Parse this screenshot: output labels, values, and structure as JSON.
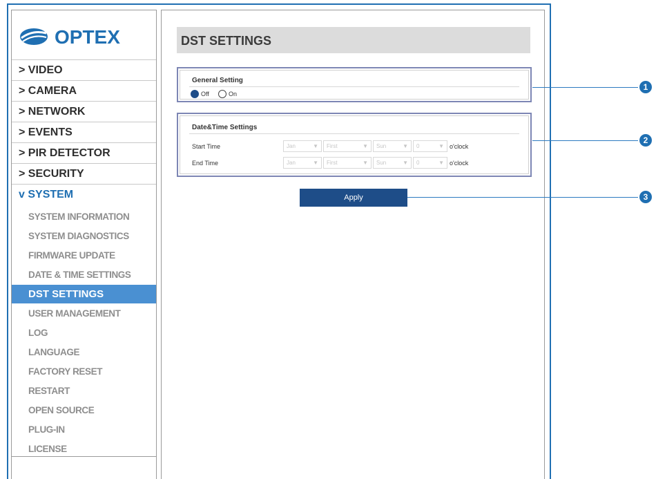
{
  "logo": {
    "text": "OPTEX"
  },
  "menu": [
    {
      "label": "> VIDEO"
    },
    {
      "label": "> CAMERA"
    },
    {
      "label": "> NETWORK"
    },
    {
      "label": "> EVENTS"
    },
    {
      "label": "> PIR DETECTOR"
    },
    {
      "label": "> SECURITY"
    },
    {
      "label": "v SYSTEM"
    }
  ],
  "submenu": [
    {
      "label": "SYSTEM INFORMATION"
    },
    {
      "label": "SYSTEM DIAGNOSTICS"
    },
    {
      "label": "FIRMWARE UPDATE"
    },
    {
      "label": "DATE & TIME SETTINGS"
    },
    {
      "label": "DST SETTINGS"
    },
    {
      "label": "USER MANAGEMENT"
    },
    {
      "label": "LOG"
    },
    {
      "label": "LANGUAGE"
    },
    {
      "label": "FACTORY RESET"
    },
    {
      "label": "RESTART"
    },
    {
      "label": "OPEN SOURCE"
    },
    {
      "label": "PLUG-IN"
    },
    {
      "label": "LICENSE"
    }
  ],
  "page": {
    "title": "DST SETTINGS"
  },
  "general": {
    "title": "General Setting",
    "off_label": "Off",
    "on_label": "On",
    "selected": "Off"
  },
  "datetime": {
    "title": "Date&Time Settings",
    "start_label": "Start Time",
    "end_label": "End Time",
    "start": {
      "month": "Jan",
      "week": "First",
      "day": "Sun",
      "hour": "0"
    },
    "end": {
      "month": "Jan",
      "week": "First",
      "day": "Sun",
      "hour": "0"
    },
    "oclock": "o'clock"
  },
  "apply_label": "Apply",
  "callouts": [
    "1",
    "2",
    "3"
  ],
  "colors": {
    "accent": "#1f6fb2",
    "button": "#1e4d88",
    "selected_menu": "#4a90d2"
  }
}
